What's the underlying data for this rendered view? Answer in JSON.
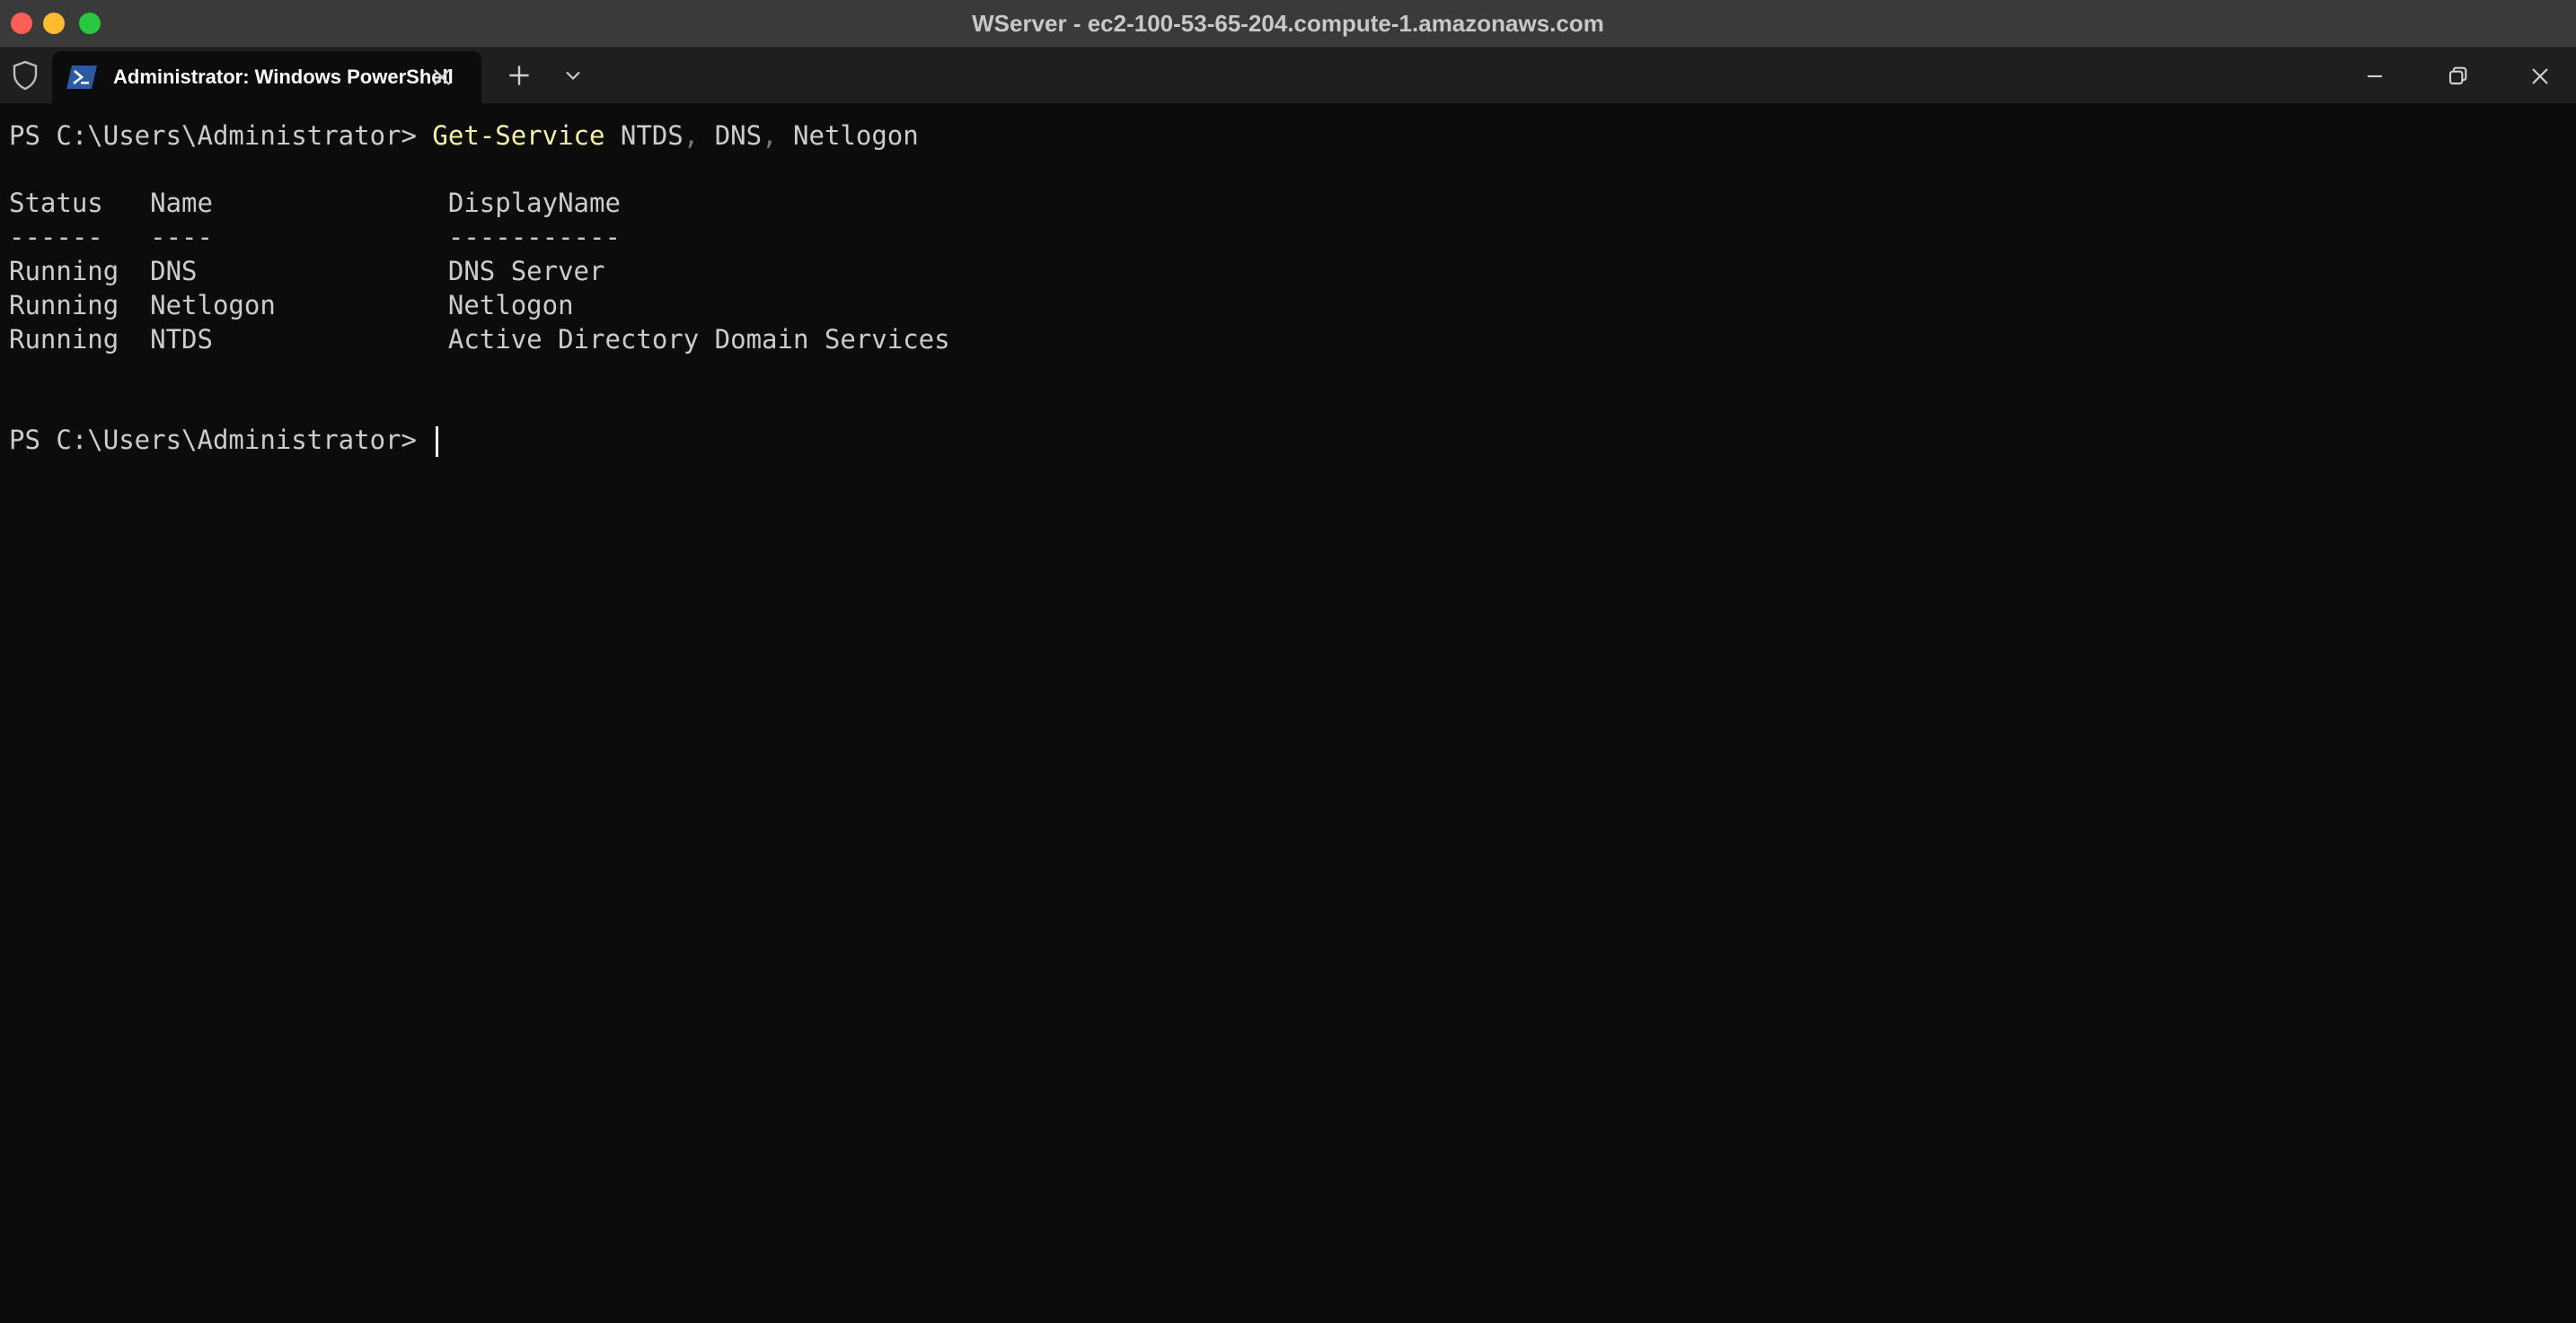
{
  "window": {
    "title": "WServer - ec2-100-53-65-204.compute-1.amazonaws.com"
  },
  "tab": {
    "title": "Administrator: Windows PowerShell"
  },
  "icons": {
    "shield": "shield-icon",
    "powershell": "powershell-icon",
    "close": "close-icon",
    "new_tab": "plus-icon",
    "dropdown": "chevron-down-icon",
    "minimize": "minimize-icon",
    "restore": "restore-icon",
    "window_close": "close-icon"
  },
  "colors": {
    "background": "#0c0c0c",
    "command": "#f9f1a5",
    "text": "#cccccc"
  },
  "terminal": {
    "prompt": "PS C:\\Users\\Administrator> ",
    "command": "Get-Service",
    "args": [
      {
        "value": " NTDS",
        "sep": ","
      },
      {
        "value": " DNS",
        "sep": ","
      },
      {
        "value": " Netlogon",
        "sep": ""
      }
    ],
    "header": "Status   Name               DisplayName",
    "underline": "------   ----               -----------",
    "rows": [
      "Running  DNS                DNS Server",
      "Running  Netlogon           Netlogon",
      "Running  NTDS               Active Directory Domain Services"
    ],
    "prompt2": "PS C:\\Users\\Administrator> "
  }
}
